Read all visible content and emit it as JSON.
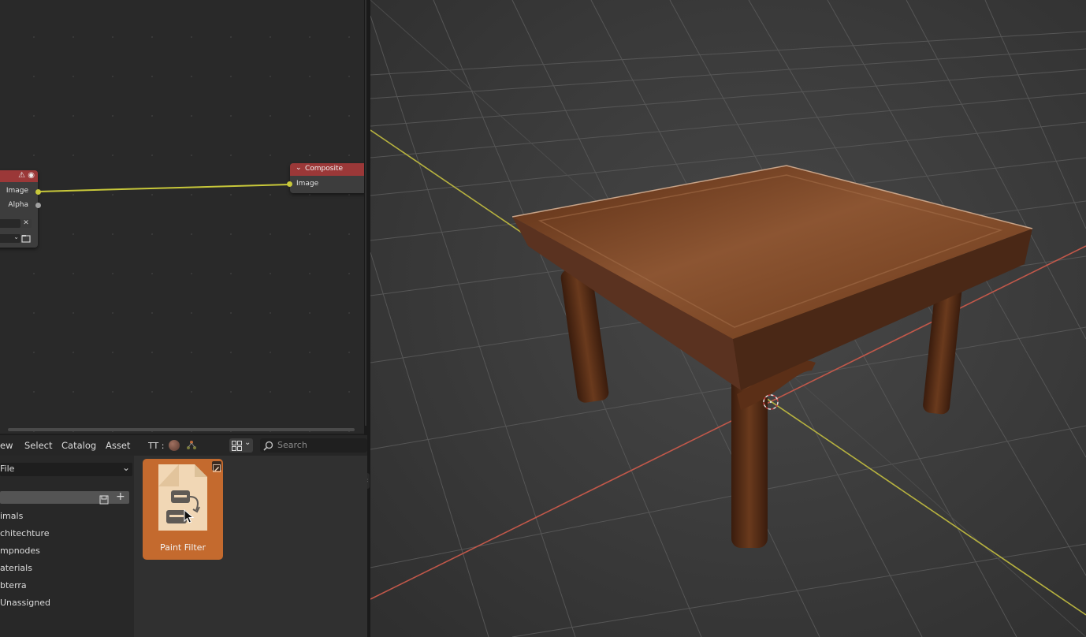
{
  "node_editor": {
    "left_node": {
      "outputs": [
        "Image",
        "Alpha"
      ]
    },
    "composite_node": {
      "title": "Composite",
      "input": "Image"
    }
  },
  "asset_browser": {
    "menu": [
      "ew",
      "Select",
      "Catalog",
      "Asset"
    ],
    "library_label": "TT :",
    "search_placeholder": "Search",
    "source_value": "File",
    "catalogs": [
      "imals",
      "chitechture",
      "mpnodes",
      "aterials",
      "bterra",
      "Unassigned"
    ],
    "asset": {
      "name": "Paint Filter",
      "icon": "node-group-icon"
    }
  },
  "colors": {
    "node_header": "#9b3838",
    "link": "#c8c83a",
    "asset_tile": "#c46a2e",
    "x_axis": "#c2584a",
    "y_axis": "#b7b23f"
  },
  "icons": [
    "warning-icon",
    "eye-icon",
    "close-icon",
    "folder-icon",
    "grid-view-icon",
    "search-icon",
    "add-icon",
    "bookmark-icon",
    "edit-icon",
    "cursor-icon",
    "3d-cursor-icon"
  ]
}
